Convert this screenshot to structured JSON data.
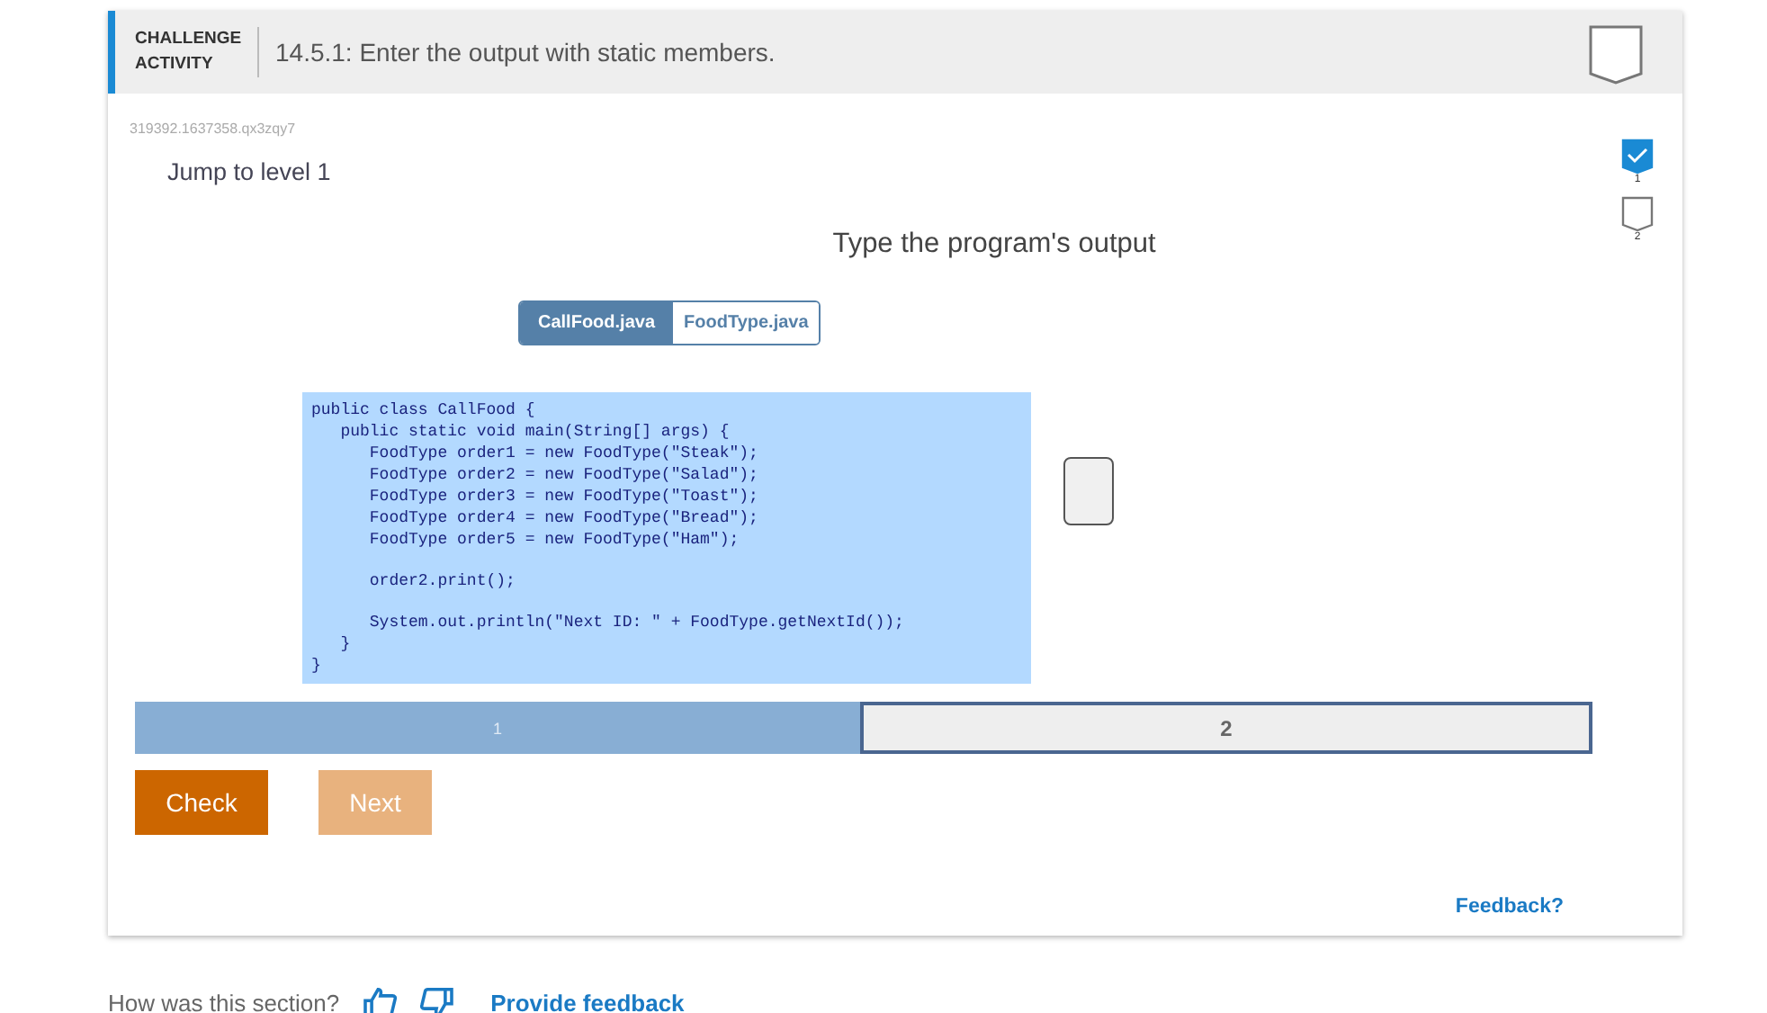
{
  "header": {
    "label": "CHALLENGE ACTIVITY",
    "title": "14.5.1: Enter the output with static members.",
    "completed": false
  },
  "activity_id": "319392.1637358.qx3zqy7",
  "jump_link": "Jump to level 1",
  "levels_indicator": [
    {
      "label": "1",
      "checked": true
    },
    {
      "label": "2",
      "checked": false
    }
  ],
  "instructions": "Type the program's output",
  "file_tabs": [
    {
      "label": "CallFood.java",
      "selected": true
    },
    {
      "label": "FoodType.java",
      "selected": false
    }
  ],
  "code_blocks": [
    [
      "public class CallFood {",
      "   public static void main(String[] args) {",
      "      FoodType order1 = new FoodType(\"Steak\");",
      "      FoodType order2 = new FoodType(\"Salad\");",
      "      FoodType order3 = new FoodType(\"Toast\");",
      "      FoodType order4 = new FoodType(\"Bread\");",
      "      FoodType order5 = new FoodType(\"Ham\");"
    ],
    [
      "      order2.print();"
    ],
    [
      "      System.out.println(\"Next ID: \" + FoodType.getNextId());",
      "   }",
      "}"
    ]
  ],
  "level_bar": [
    {
      "label": "1",
      "completed": true,
      "selected": false
    },
    {
      "label": "2",
      "completed": false,
      "selected": true
    }
  ],
  "buttons": [
    {
      "label": "Check",
      "disabled": false
    },
    {
      "label": "Next",
      "disabled": true
    }
  ],
  "feedback_link": "Feedback?",
  "footer": {
    "question": "How was this section?",
    "link": "Provide feedback"
  }
}
